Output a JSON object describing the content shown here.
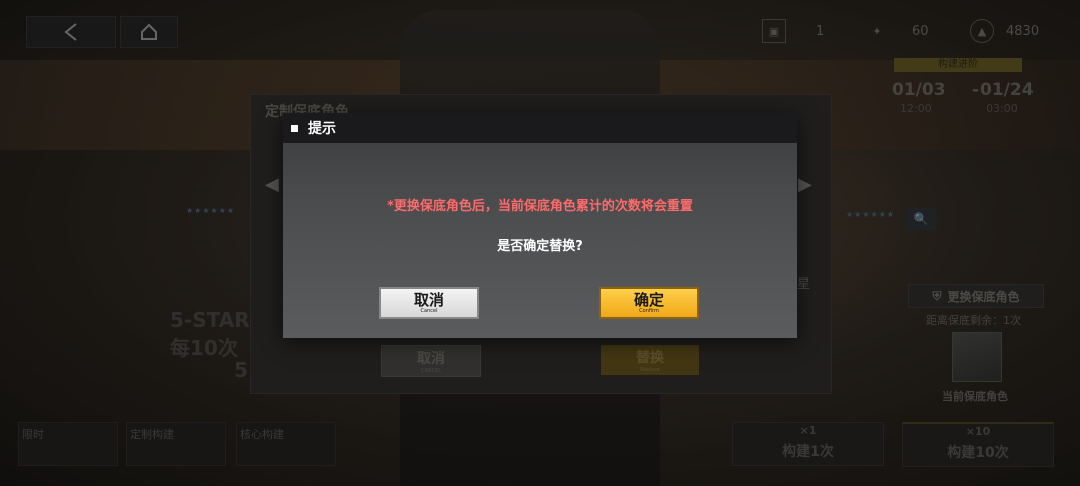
{
  "topbar": {
    "resources": [
      {
        "icon": "ticket-icon",
        "value": "1"
      },
      {
        "icon": "star-token-icon",
        "value": "60"
      },
      {
        "icon": "crystal-icon",
        "value": "4830"
      }
    ]
  },
  "event": {
    "tag": "构建进阶",
    "start_date": "01/03",
    "start_time": "12:00",
    "end_date": "01/24",
    "end_time": "03:00"
  },
  "background_panel": {
    "title": "定制保底角色",
    "cancel_label": "取消",
    "cancel_sub": "CANCEL",
    "replace_label": "替换",
    "replace_sub": "Replace",
    "side_text": "星"
  },
  "left": {
    "five_star": "5-STAR",
    "every_ten": "每10次",
    "five": "5"
  },
  "right": {
    "replace_button": "更换保底角色",
    "remaining_label": "距离保底剩余：1次",
    "current_label": "当前保底角色",
    "draw_one_cost": "×1",
    "draw_one_label": "构建1次",
    "draw_ten_cost": "×10",
    "draw_ten_label": "构建10次"
  },
  "tabs": [
    {
      "label": "限时"
    },
    {
      "label": "定制构建"
    },
    {
      "label": "核心构建"
    }
  ],
  "modal": {
    "title": "提示",
    "warning": "*更换保底角色后，当前保底角色累计的次数将会重置",
    "question": "是否确定替换?",
    "cancel_label": "取消",
    "cancel_sub": "Cancel",
    "confirm_label": "确定",
    "confirm_sub": "Confirm"
  },
  "colors": {
    "warning": "#ff6a6a",
    "confirm": "#f0a818",
    "header": "#1a1a1c"
  }
}
